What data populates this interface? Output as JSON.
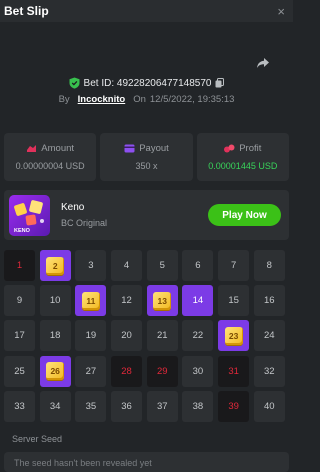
{
  "header": {
    "title": "Bet Slip",
    "close_icon": "×"
  },
  "bet": {
    "id_text": "Bet ID: 49228206477148570",
    "by_label": "By",
    "user": "Incocknito",
    "on_label": "On",
    "date": "12/5/2022, 19:35:13"
  },
  "stats": {
    "amount": {
      "label": "Amount",
      "value": "0.00000004 USD"
    },
    "payout": {
      "label": "Payout",
      "value": "350 x"
    },
    "profit": {
      "label": "Profit",
      "value": "0.00001445 USD"
    }
  },
  "game": {
    "name": "Keno",
    "subtitle": "BC Original",
    "play_label": "Play Now",
    "thumb_text": "KENO"
  },
  "grid": {
    "cells": [
      {
        "n": "1",
        "s": "miss"
      },
      {
        "n": "2",
        "s": "gem"
      },
      {
        "n": "3",
        "s": ""
      },
      {
        "n": "4",
        "s": ""
      },
      {
        "n": "5",
        "s": ""
      },
      {
        "n": "6",
        "s": ""
      },
      {
        "n": "7",
        "s": ""
      },
      {
        "n": "8",
        "s": ""
      },
      {
        "n": "9",
        "s": ""
      },
      {
        "n": "10",
        "s": ""
      },
      {
        "n": "11",
        "s": "gem"
      },
      {
        "n": "12",
        "s": ""
      },
      {
        "n": "13",
        "s": "gem"
      },
      {
        "n": "14",
        "s": "hit"
      },
      {
        "n": "15",
        "s": ""
      },
      {
        "n": "16",
        "s": ""
      },
      {
        "n": "17",
        "s": ""
      },
      {
        "n": "18",
        "s": ""
      },
      {
        "n": "19",
        "s": ""
      },
      {
        "n": "20",
        "s": ""
      },
      {
        "n": "21",
        "s": ""
      },
      {
        "n": "22",
        "s": ""
      },
      {
        "n": "23",
        "s": "gem"
      },
      {
        "n": "24",
        "s": ""
      },
      {
        "n": "25",
        "s": ""
      },
      {
        "n": "26",
        "s": "gem"
      },
      {
        "n": "27",
        "s": ""
      },
      {
        "n": "28",
        "s": "miss"
      },
      {
        "n": "29",
        "s": "miss"
      },
      {
        "n": "30",
        "s": ""
      },
      {
        "n": "31",
        "s": "miss"
      },
      {
        "n": "32",
        "s": ""
      },
      {
        "n": "33",
        "s": ""
      },
      {
        "n": "34",
        "s": ""
      },
      {
        "n": "35",
        "s": ""
      },
      {
        "n": "36",
        "s": ""
      },
      {
        "n": "37",
        "s": ""
      },
      {
        "n": "38",
        "s": ""
      },
      {
        "n": "39",
        "s": "miss"
      },
      {
        "n": "40",
        "s": ""
      }
    ]
  },
  "seed": {
    "label": "Server Seed",
    "text": "The seed hasn't been revealed yet"
  },
  "colors": {
    "accent": "#7c3be6",
    "play": "#3bc117",
    "profit": "#38d35a",
    "miss": "#e0283a"
  }
}
